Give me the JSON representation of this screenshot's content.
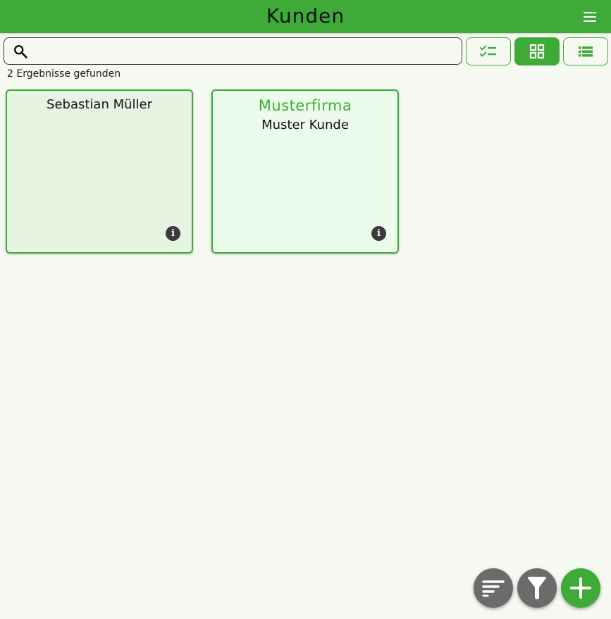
{
  "header": {
    "title": "Kunden",
    "menu_icon": "hamburger-menu-icon"
  },
  "search": {
    "value": "",
    "placeholder": "",
    "icon": "search-icon"
  },
  "toolbar": {
    "buttons": [
      {
        "icon": "checklist-icon",
        "active": false
      },
      {
        "icon": "grid-view-icon",
        "active": true
      },
      {
        "icon": "list-view-icon",
        "active": false
      }
    ]
  },
  "results": {
    "count_text": "2 Ergebnisse gefunden"
  },
  "cards": [
    {
      "company": "",
      "name": "Sebastian Müller",
      "info_icon": "info-icon"
    },
    {
      "company": "Musterfirma",
      "name": "Muster Kunde",
      "info_icon": "info-icon"
    }
  ],
  "fabs": [
    {
      "icon": "sort-icon"
    },
    {
      "icon": "filter-icon"
    },
    {
      "icon": "add-icon"
    }
  ],
  "colors": {
    "accent": "#3eab39",
    "background": "#f6f9f1",
    "card_bg_1": "#e6f4e2",
    "card_bg_2": "#ebfdea",
    "fab_gray": "#6b6b6b"
  }
}
